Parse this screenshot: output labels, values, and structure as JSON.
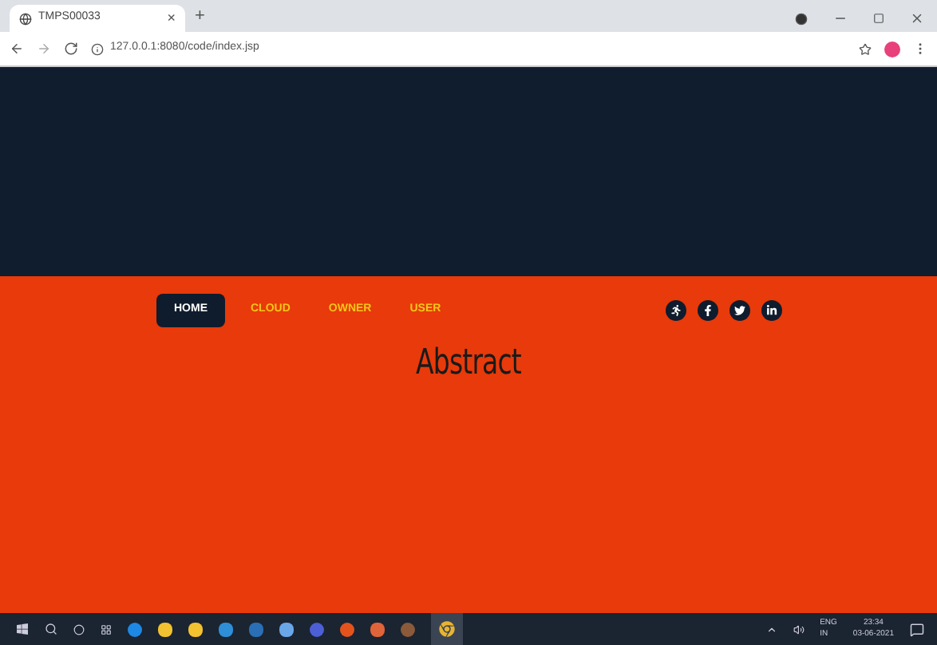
{
  "browser": {
    "tab_title": "TMPS00033",
    "tab_close": "×",
    "new_tab": "+",
    "url": "127.0.0.1:8080/code/index.jsp"
  },
  "nav": [
    {
      "label": "HOME",
      "selected": true
    },
    {
      "label": "CLOUD",
      "selected": false
    },
    {
      "label": "OWNER",
      "selected": false
    },
    {
      "label": "USER",
      "selected": false
    }
  ],
  "heading": "Abstract",
  "taskbar": {
    "language": "ENG",
    "region": "IN",
    "time": "23:34",
    "date": "03-06-2021"
  }
}
